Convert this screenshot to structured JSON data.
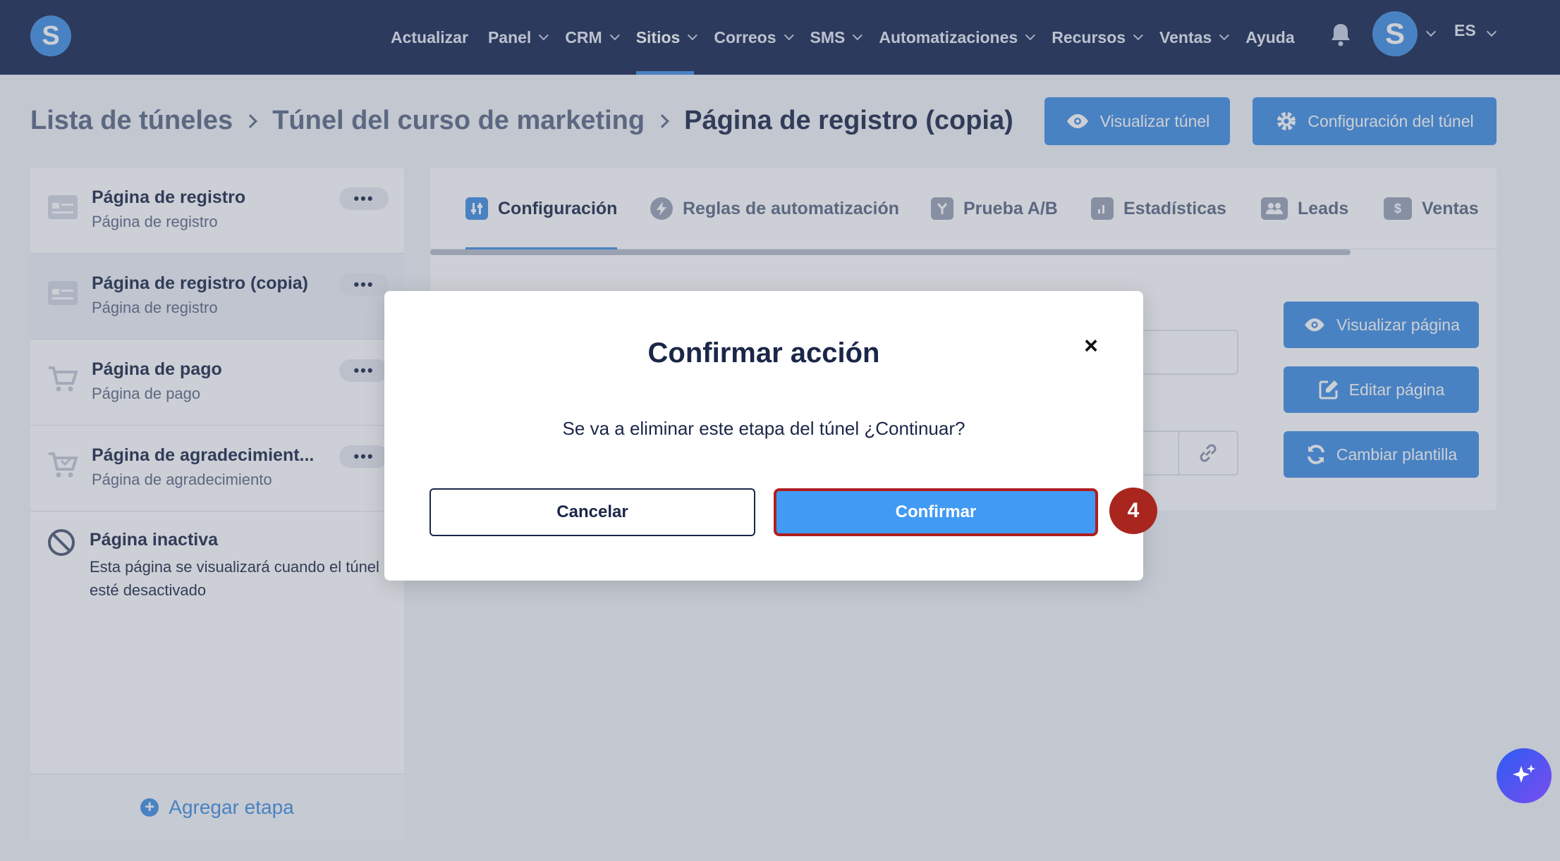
{
  "nav": {
    "logo_letter": "S",
    "items": [
      {
        "label": "Actualizar",
        "dropdown": false
      },
      {
        "label": "Panel",
        "dropdown": true
      },
      {
        "label": "CRM",
        "dropdown": true
      },
      {
        "label": "Sitios",
        "dropdown": true,
        "active": true
      },
      {
        "label": "Correos",
        "dropdown": true
      },
      {
        "label": "SMS",
        "dropdown": true
      },
      {
        "label": "Automatizaciones",
        "dropdown": true
      },
      {
        "label": "Recursos",
        "dropdown": true
      },
      {
        "label": "Ventas",
        "dropdown": true
      },
      {
        "label": "Ayuda",
        "dropdown": false
      }
    ],
    "avatar_letter": "S",
    "language": "ES",
    "icons": {
      "bell": "bell-icon"
    }
  },
  "breadcrumb": {
    "items": [
      "Lista de túneles",
      "Túnel del curso de marketing",
      "Página de registro (copia)"
    ]
  },
  "header_actions": {
    "preview_funnel": "Visualizar túnel",
    "funnel_settings": "Configuración del túnel"
  },
  "sidebar": {
    "stages": [
      {
        "title": "Página de registro",
        "subtitle": "Página de registro",
        "icon": "form-page-icon"
      },
      {
        "title": "Página de registro (copia)",
        "subtitle": "Página de registro",
        "icon": "form-page-icon",
        "selected": true
      },
      {
        "title": "Página de pago",
        "subtitle": "Página de pago",
        "icon": "cart-icon"
      },
      {
        "title": "Página de agradecimient...",
        "subtitle": "Página de agradecimiento",
        "icon": "cart-check-icon"
      }
    ],
    "more_label": "•••",
    "inactive": {
      "title": "Página inactiva",
      "description": "Esta página se visualizará cuando el túnel esté desactivado"
    },
    "add_stage": "Agregar etapa",
    "add_icon": "+"
  },
  "tabs": [
    {
      "label": "Configuración",
      "icon": "sliders-icon",
      "active": true
    },
    {
      "label": "Reglas de automatización",
      "icon": "lightning-icon"
    },
    {
      "label": "Prueba A/B",
      "icon": "split-icon"
    },
    {
      "label": "Estadísticas",
      "icon": "bar-chart-icon"
    },
    {
      "label": "Leads",
      "icon": "users-icon"
    },
    {
      "label": "Ventas",
      "icon": "dollar-icon",
      "icon_glyph": "$"
    }
  ],
  "page_actions": {
    "preview_page": "Visualizar página",
    "edit_page": "Editar página",
    "change_template": "Cambiar plantilla"
  },
  "modal": {
    "title": "Confirmar acción",
    "close": "×",
    "message": "Se va a eliminar este etapa del túnel ¿Continuar?",
    "cancel": "Cancelar",
    "confirm": "Confirmar"
  },
  "step_badge": "4",
  "colors": {
    "nav_bg": "#14244e",
    "accent": "#3f8ee3",
    "confirm_bg": "#419bf4",
    "highlight_border": "#b01e1e",
    "badge": "#a9261f"
  }
}
